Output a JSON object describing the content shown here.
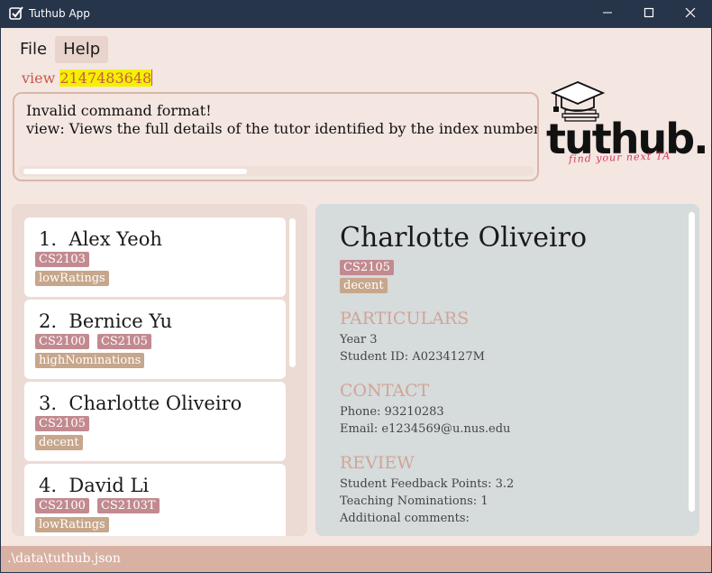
{
  "window": {
    "title": "Tuthub App"
  },
  "menu": {
    "items": [
      "File",
      "Help"
    ]
  },
  "command": {
    "prefix": "view ",
    "highlighted": "2147483648"
  },
  "result": {
    "line1": "Invalid command format!",
    "line2": "view: Views the full details of the tutor identified by the index number use"
  },
  "logo": {
    "word": "tuthub.",
    "tagline": "find your next TA"
  },
  "tutors": [
    {
      "index": "1.",
      "name": "Alex Yeoh",
      "modules": [
        "CS2103"
      ],
      "rating": "lowRatings"
    },
    {
      "index": "2.",
      "name": "Bernice Yu",
      "modules": [
        "CS2100",
        "CS2105"
      ],
      "rating": "highNominations"
    },
    {
      "index": "3.",
      "name": "Charlotte Oliveiro",
      "modules": [
        "CS2105"
      ],
      "rating": "decent"
    },
    {
      "index": "4.",
      "name": "David Li",
      "modules": [
        "CS2100",
        "CS2103T"
      ],
      "rating": "lowRatings"
    }
  ],
  "detail": {
    "name": "Charlotte Oliveiro",
    "module": "CS2105",
    "rating": "decent",
    "particulars": {
      "heading": "PARTICULARS",
      "year": "Year 3",
      "student_id": "Student ID: A0234127M"
    },
    "contact": {
      "heading": "CONTACT",
      "phone": "Phone: 93210283",
      "email": "Email: e1234569@u.nus.edu"
    },
    "review": {
      "heading": "REVIEW",
      "points": "Student Feedback Points: 3.2",
      "nominations": "Teaching Nominations: 1",
      "comments": "Additional comments:"
    }
  },
  "status": {
    "path": ".\\data\\tuthub.json"
  },
  "colors": {
    "module_tag": "#c28a8f",
    "rating_tag": "#c7a68b",
    "command_text": "#c65a4b",
    "highlight": "#f5f000"
  },
  "icons": {
    "app": "check-icon",
    "minimize": "minimize-icon",
    "maximize": "maximize-icon",
    "close": "close-icon",
    "logo": "graduation-cap-icon"
  }
}
